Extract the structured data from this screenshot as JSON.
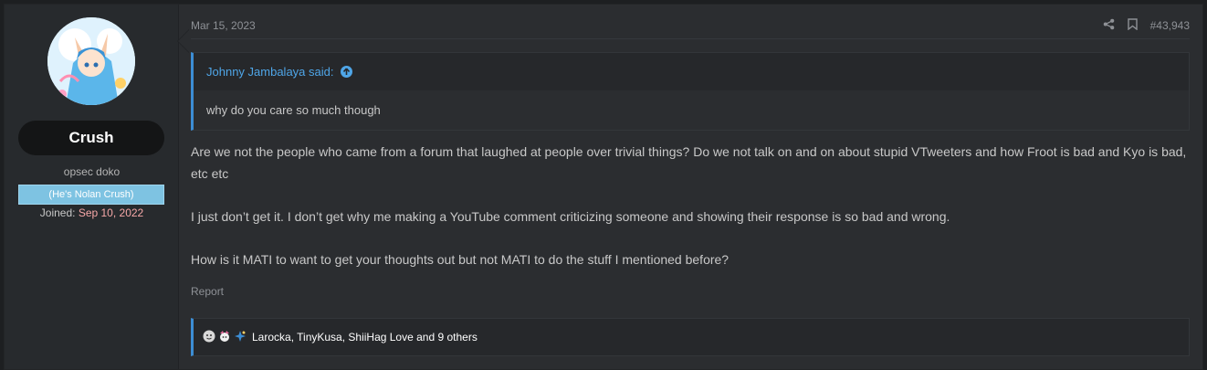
{
  "user": {
    "username": "Crush",
    "user_title": "opsec doko",
    "banner": "(He's Nolan Crush)",
    "joined_label": "Joined:",
    "joined_date": "Sep 10, 2022"
  },
  "post": {
    "date": "Mar 15, 2023",
    "post_number": "#43,943",
    "quote": {
      "author": "Johnny Jambalaya said:",
      "text": "why do you care so much though"
    },
    "paragraphs": [
      "Are we not the people who came from a forum that laughed at people over trivial things? Do we not talk on and on about stupid VTweeters and how Froot is bad and Kyo is bad, etc etc",
      "I just don’t get it. I don’t get why me making a YouTube comment criticizing someone and showing their response is so bad and wrong.",
      "How is it MATI to want to get your thoughts out but not MATI to do the stuff I mentioned before?"
    ],
    "report_label": "Report",
    "reactions_text": "Larocka, TinyKusa, ShiiHag Love and 9 others"
  },
  "colors": {
    "accent": "#3c8dd4",
    "link": "#4fa6e8",
    "banner": "#7ec3e2",
    "joined_date": "#f7a8a8"
  }
}
